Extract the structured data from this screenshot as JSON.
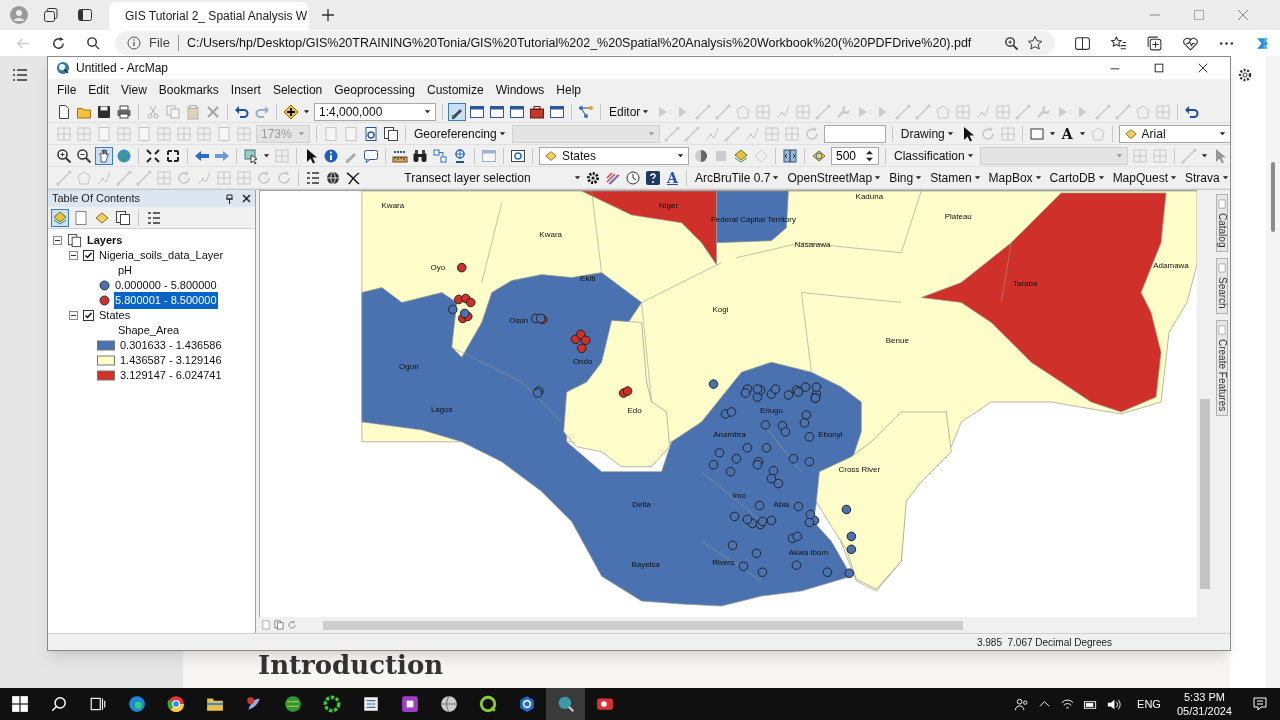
{
  "browser": {
    "tab_title": "GIS Tutorial 2_ Spatial Analysis W",
    "address_scheme": "File",
    "url": "C:/Users/hp/Desktop/GIS%20TRAINING%20Tonia/GIS%20Tutorial%202_%20Spatial%20Analysis%20Workbook%20(%20PDFDrive%20).pdf"
  },
  "window": {
    "title": "Untitled - ArcMap"
  },
  "menu": [
    "File",
    "Edit",
    "View",
    "Bookmarks",
    "Insert",
    "Selection",
    "Geoprocessing",
    "Customize",
    "Windows",
    "Help"
  ],
  "toolbars": {
    "scale": "1:4,000,000",
    "editor": "Editor",
    "zoom_percent": "173%",
    "georeferencing": "Georeferencing",
    "drawing": "Drawing",
    "font_color": "A",
    "font": "Arial",
    "target_layer": "States",
    "tolerance": "500",
    "classification": "Classification",
    "transect": "Transect layer selection",
    "text_color": "A",
    "tile_menus": [
      "ArcBruTile 0.7",
      "OpenStreetMap",
      "Bing",
      "Stamen",
      "MapBox",
      "CartoDB",
      "MapQuest",
      "Strava"
    ]
  },
  "toc": {
    "title": "Table Of Contents",
    "layers": {
      "label": "Layers",
      "expanded": true,
      "children": [
        {
          "label": "Nigeria_soils_data_Layer",
          "checked": true,
          "expanded": true,
          "field": "pH",
          "kind": "point",
          "classes": [
            {
              "label": "0.000000 - 5.800000",
              "color": "#4a72b0",
              "selected": false
            },
            {
              "label": "5.800001 - 8.500000",
              "color": "#d0302a",
              "selected": true
            }
          ]
        },
        {
          "label": "States",
          "checked": true,
          "expanded": true,
          "field": "Shape_Area",
          "kind": "polygon",
          "classes": [
            {
              "label": "0.301633 - 1.436586",
              "color": "#4a72b0",
              "selected": false
            },
            {
              "label": "1.436587 - 3.129146",
              "color": "#fffdca",
              "selected": false
            },
            {
              "label": "3.129147 - 6.024741",
              "color": "#d0302a",
              "selected": false
            }
          ]
        }
      ]
    }
  },
  "map": {
    "labels": [
      "Kwara",
      "Kwara",
      "Niger",
      "Federal Capital Territory",
      "Kaduna",
      "Plateau",
      "Nasarawa",
      "Adamawa",
      "Oyo",
      "Taraba",
      "Ekiti",
      "Osun",
      "Kogi",
      "Benue",
      "Ogun",
      "Ondo",
      "Lagos",
      "Edo",
      "Enugu",
      "Anambra",
      "Ebonyi",
      "Cross River",
      "Delta",
      "Imo",
      "Abia",
      "Bayelsa",
      "Rivers",
      "Akwa Ibom"
    ]
  },
  "dock_tabs": [
    "Catalog",
    "Search",
    "Create Features"
  ],
  "status_bar": {
    "coordinates": "3.985  7.067 Decimal Degrees"
  },
  "document": {
    "heading": "Introduction"
  },
  "taskbar": {
    "language": "ENG",
    "time": "5:33 PM",
    "date": "05/31/2024"
  }
}
